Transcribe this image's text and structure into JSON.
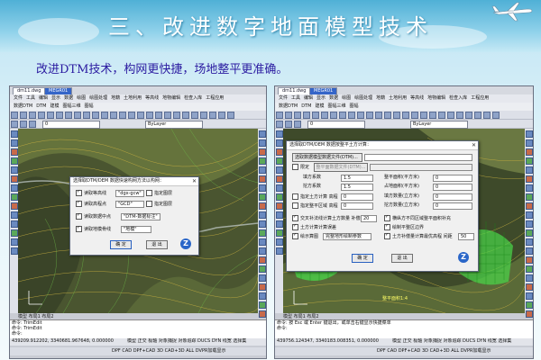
{
  "slide": {
    "title": "三、改进数字地面模型技术",
    "subtitle": "改进DTM技术，构网更快捷，场地整平更准确。"
  },
  "left_window": {
    "tabs": [
      "dm11.dwg",
      "MEGR01"
    ],
    "menu": [
      "文件",
      "工具",
      "编辑",
      "显示",
      "数据",
      "绘图",
      "绘图处理",
      "地籍",
      "土地利用",
      "等高线",
      "地物编辑",
      "检查入库",
      "工程应用",
      "其他应用",
      "帮助"
    ],
    "submenu": [
      "数据DTM",
      "DTM",
      "建模",
      "图幅三维",
      "图幅",
      "地籍"
    ],
    "layer_label": "0",
    "layer_value": "ByLayer",
    "model_tabs": [
      "模型",
      "布局1",
      "布局2"
    ],
    "command_lines": [
      "命令: TrimEdit",
      "命令: TrimEdit",
      "命令:"
    ],
    "coordinates": "439209.912202, 3340681.967648, 0.000000",
    "status_items": [
      "模型",
      "正交",
      "极轴",
      "对象捕捉",
      "对象追踪",
      "DUCS",
      "DYN",
      "线宽",
      "选择集"
    ],
    "bottom_items": [
      "DPF",
      "CAD",
      "DPF+CAD",
      "3D",
      "CAD+3D",
      "ALL",
      "DVPR加载显示"
    ]
  },
  "left_dialog": {
    "title": "选择取DTM/DEM 数据快速构网方法以构网：",
    "close": "✕",
    "options": [
      {
        "label": "读取等高线",
        "checked": true,
        "field": "\"dgx-gcw\"",
        "opt": "指定图层"
      },
      {
        "label": "读取高程点",
        "checked": true,
        "field": "\"GCD\"",
        "opt": "指定图层"
      },
      {
        "label": "读取数据中点",
        "checked": true,
        "field": "\"DTM-数据标注\"",
        "opt": ""
      },
      {
        "label": "读取地模骨线",
        "checked": true,
        "field": "\"地模\"",
        "opt": ""
      }
    ],
    "ok": "确 定",
    "cancel": "退 出"
  },
  "right_window": {
    "tabs": [
      "dm11.dwg",
      "MEGR01"
    ],
    "menu": [
      "文件",
      "工具",
      "编辑",
      "显示",
      "数据",
      "绘图",
      "绘图处理",
      "地籍",
      "土地利用",
      "等高线",
      "地物编辑",
      "检查入库",
      "工程应用",
      "其他应用",
      "帮助"
    ],
    "submenu": [
      "数据DTM",
      "DTM",
      "建模",
      "图幅三维",
      "图幅",
      "地籍"
    ],
    "layer_label": "0",
    "layer_value": "ByLayer",
    "model_tabs": [
      "模型",
      "布局1",
      "布局2"
    ],
    "command_lines": [
      "命令: 按 Esc 或 Enter 键退出，或单击右键显示快捷菜单",
      "命令:"
    ],
    "coordinates": "439756.124347, 3340183.008351, 0.000000",
    "status_items": [
      "模型",
      "正交",
      "极轴",
      "对象捕捉",
      "对象追踪",
      "DUCS",
      "DYN",
      "线宽",
      "选择集"
    ],
    "bottom_items": [
      "DPF",
      "CAD",
      "DPF+CAD",
      "3D",
      "CAD+3D",
      "ALL",
      "DVPR加载显示"
    ],
    "map_note": "整平面积1:4"
  },
  "right_dialog": {
    "title": "选择取DTM/DEM 数据按整平土方计算：",
    "close": "✕",
    "file_button": "选取数据模型数据文件(DTM)...",
    "limit_label": "限定",
    "limit_button": "整平面数据文件(DTM)...",
    "left_fields": [
      {
        "label": "填方系数",
        "value": "1.5"
      },
      {
        "label": "挖方系数",
        "value": "1.5"
      },
      {
        "label": "指定土方计算 高程",
        "value": "0"
      },
      {
        "label": "指定整平区域 高程",
        "value": "0"
      }
    ],
    "right_fields": [
      {
        "label": "整平面积(平方米)",
        "value": "0"
      },
      {
        "label": "占地面积(平方米)",
        "value": "0"
      },
      {
        "label": "填方数量(立方米)",
        "value": "0"
      },
      {
        "label": "挖方数量(立方米)",
        "value": "0"
      }
    ],
    "checks": [
      {
        "label": "交叉补法线计算土方数量 补偿",
        "value": "20",
        "checked": true
      },
      {
        "label": "土方计算计算误差",
        "value": "",
        "checked": true
      },
      {
        "label": "绘示算图",
        "value": "",
        "checked": true
      },
      {
        "label": "横纵方不同区域整平面积补充",
        "value": "",
        "checked": true
      },
      {
        "label": "绘制平整区边界",
        "value": "",
        "checked": true
      },
      {
        "label": "土方补偿量计算最优高程 间距",
        "value": "50",
        "checked": true
      }
    ],
    "select_label": "完整地形绘制参数",
    "ok": "确 定",
    "cancel": "退 出"
  }
}
